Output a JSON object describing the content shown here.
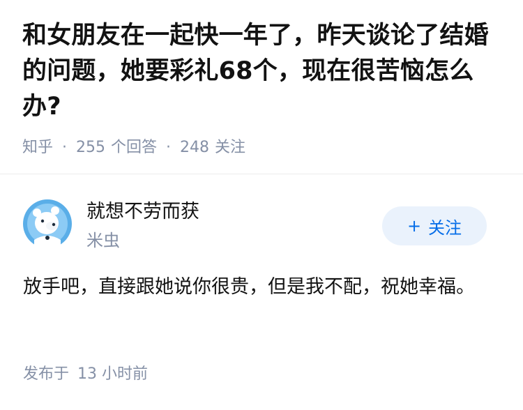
{
  "question": {
    "title": "和女朋友在一起快一年了，昨天谈论了结婚的问题，她要彩礼68个，现在很苦恼怎么办?",
    "source": "知乎",
    "answer_count": "255",
    "answer_unit": "个回答",
    "follow_count": "248",
    "follow_unit": "关注"
  },
  "answer": {
    "author_name": "就想不劳而获",
    "author_sub": "米虫",
    "follow_button": {
      "icon": "plus-icon",
      "label": "关注"
    },
    "avatar_icon": "polar-bear-avatar-icon",
    "content": "放手吧，直接跟她说你很贵，但是我不配，祝她幸福。",
    "published_prefix": "发布于",
    "published_time": "13 小时前"
  },
  "colors": {
    "meta_gray": "#8590a6",
    "accent_blue": "#056de8",
    "follow_bg": "#eaf2fc",
    "avatar_bg": "#5aaee8"
  }
}
